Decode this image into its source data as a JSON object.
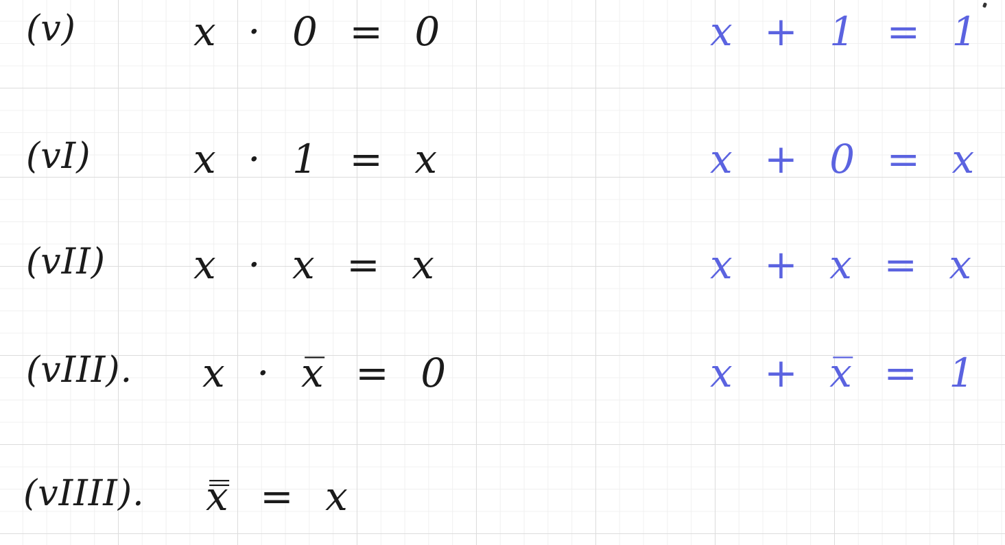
{
  "laws": [
    {
      "label": "(v)",
      "law": "x · 0 = 0",
      "dual": "x + 1 = 1"
    },
    {
      "label": "(vI)",
      "law": "x · 1 = x",
      "dual": "x + 0 = x"
    },
    {
      "label": "(vII)",
      "law": "x · x = x",
      "dual": "x + x = x"
    },
    {
      "label": "(vIII).",
      "law": "x · x̅ = 0",
      "dual": "x + x̅ = 1"
    },
    {
      "label": "(vIIII).",
      "law": "x̿ = x",
      "dual": ""
    }
  ],
  "colors": {
    "ink_black": "#1b1b1b",
    "ink_blue": "#5b63e0",
    "grid_major": "#dcdcdc",
    "grid_minor": "#f0f0f0"
  }
}
